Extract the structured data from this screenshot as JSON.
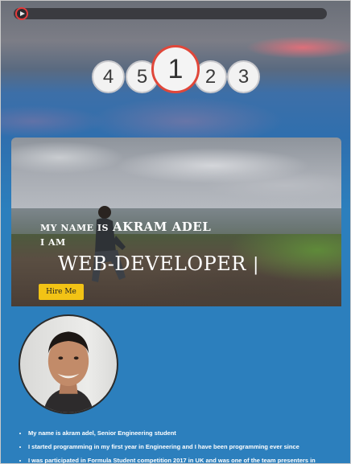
{
  "pager": {
    "pages": [
      "4",
      "5",
      "1",
      "2",
      "3"
    ],
    "active": "1"
  },
  "hero": {
    "intro": "MY NAME IS",
    "name": "AKRAM ADEL",
    "iam": "I AM",
    "role": "WEB-DEVELOPER",
    "cursor": "|",
    "hire_label": "Hire Me"
  },
  "bio": {
    "items": [
      "My name is akram adel, Senior Engineering student",
      "I started programming in my first year in Engineering and I have been programming ever since",
      "I was participated in Formula Student competition 2017 in UK and was one of the team presenters in"
    ]
  },
  "colors": {
    "page_blue": "#2c7fbd",
    "hire_button": "#f2c315",
    "active_ring": "#e0473a"
  }
}
